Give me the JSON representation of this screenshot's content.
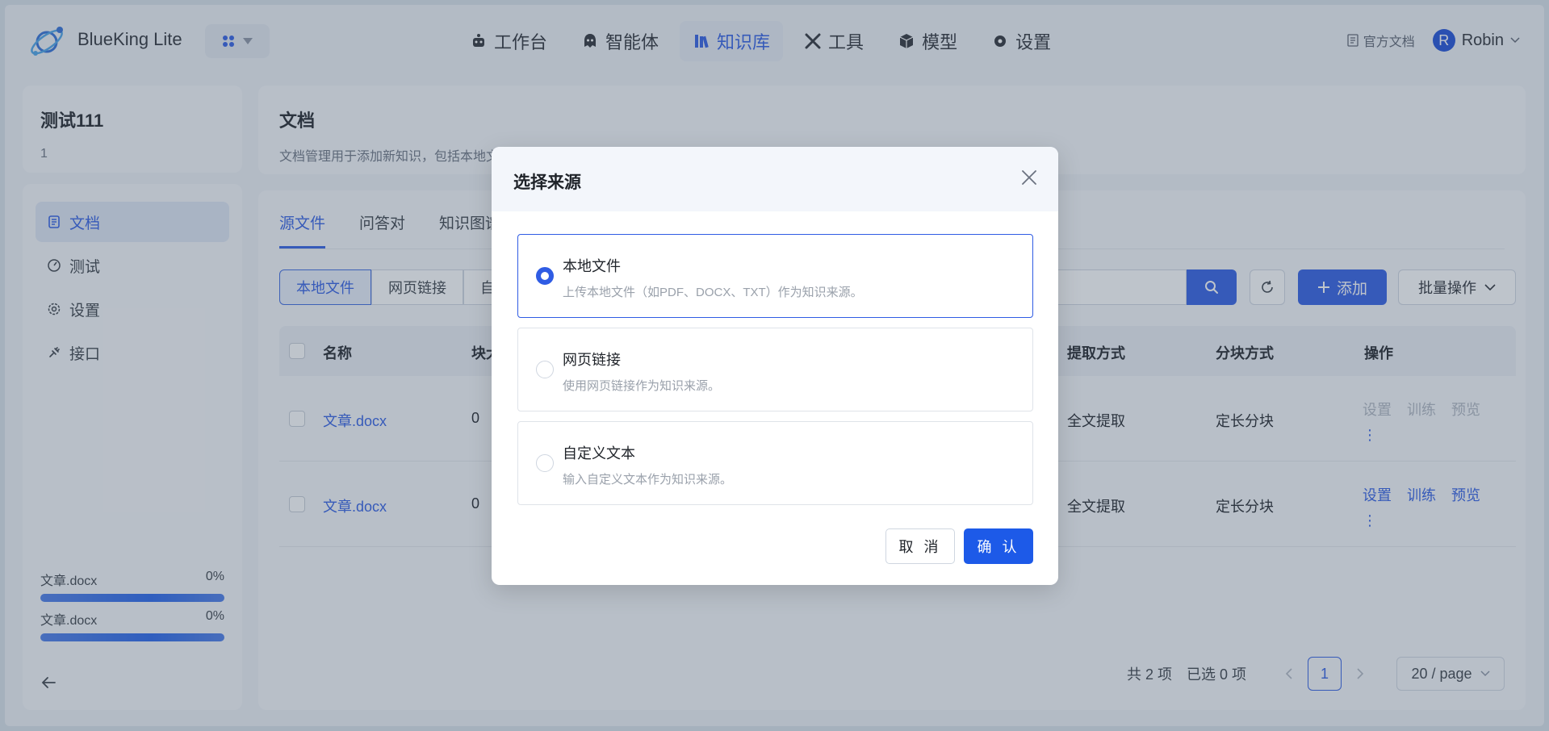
{
  "brand": {
    "name": "BlueKing Lite"
  },
  "nav": [
    {
      "label": "工作台",
      "icon": "robot-icon"
    },
    {
      "label": "智能体",
      "icon": "agent-icon"
    },
    {
      "label": "知识库",
      "icon": "library-icon",
      "active": true
    },
    {
      "label": "工具",
      "icon": "tools-icon"
    },
    {
      "label": "模型",
      "icon": "cube-icon"
    },
    {
      "label": "设置",
      "icon": "gear-icon"
    }
  ],
  "topright": {
    "docs": "官方文档",
    "user": "Robin",
    "avatar_letter": "R"
  },
  "kb": {
    "title": "测试111",
    "subtitle": "1"
  },
  "sidebar": [
    {
      "label": "文档",
      "active": true
    },
    {
      "label": "测试"
    },
    {
      "label": "设置"
    },
    {
      "label": "接口"
    }
  ],
  "uploads": [
    {
      "name": "文章.docx",
      "percent": "0%",
      "progress": 1.0
    },
    {
      "name": "文章.docx",
      "percent": "0%",
      "progress": 1.0
    }
  ],
  "main": {
    "title": "文档",
    "desc": "文档管理用于添加新知识，包括本地文件、网页链接或自定义文本。新添加的知识可以分块，以便机器人使用。",
    "tabs": [
      "源文件",
      "问答对",
      "知识图谱"
    ],
    "filters": [
      "本地文件",
      "网页链接",
      "自定义文本"
    ],
    "add_label": "添加",
    "bulk_label": "批量操作"
  },
  "table": {
    "headers": {
      "name": "名称",
      "chunk": "块大小",
      "extract": "提取方式",
      "chunking": "分块方式",
      "ops": "操作"
    },
    "rows": [
      {
        "name": "文章.docx",
        "chunk": "0",
        "extract": "全文提取",
        "chunking": "定长分块",
        "ops_enabled": false
      },
      {
        "name": "文章.docx",
        "chunk": "0",
        "extract": "全文提取",
        "chunking": "定长分块",
        "ops_enabled": true
      }
    ],
    "ops": {
      "settings": "设置",
      "train": "训练",
      "preview": "预览",
      "more": "⋮"
    }
  },
  "pager": {
    "total": "共 2 项",
    "selected": "已选 0 项",
    "page": "1",
    "page_size": "20 / page"
  },
  "modal": {
    "title": "选择来源",
    "options": [
      {
        "title": "本地文件",
        "desc": "上传本地文件（如PDF、DOCX、TXT）作为知识来源。",
        "selected": true
      },
      {
        "title": "网页链接",
        "desc": "使用网页链接作为知识来源。",
        "selected": false
      },
      {
        "title": "自定义文本",
        "desc": "输入自定义文本作为知识来源。",
        "selected": false
      }
    ],
    "cancel": "取 消",
    "confirm": "确 认"
  },
  "colors": {
    "accent": "#2f5ce4",
    "primary_button": "#1d5ae8"
  }
}
